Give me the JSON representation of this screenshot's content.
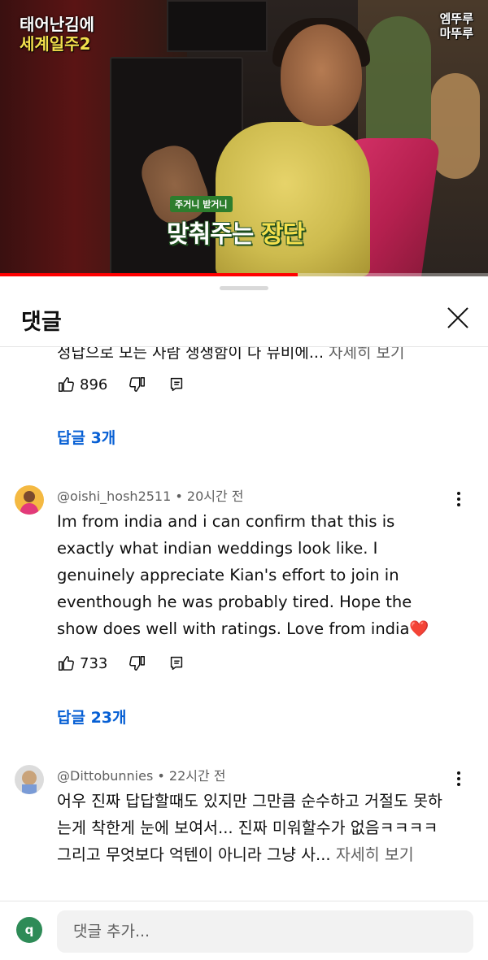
{
  "video": {
    "logo_left_line1": "태어난김에",
    "logo_left_line2": "세계일주2",
    "logo_right_line1": "엠뚜루",
    "logo_right_line2": "마뚜루",
    "caption_small": "주거니 받거니",
    "caption_main_a": "맞춰주는 ",
    "caption_main_b": "장단",
    "progress": 0.61,
    "colors": {
      "progress": "#ff0000"
    }
  },
  "sheet": {
    "title": "댓글",
    "close_icon": "close-icon"
  },
  "truncated_comment": {
    "text": "정답으로 모든 사람 생생함이 다 뮤비에...",
    "more": "자세히 보기",
    "likes": "896",
    "replies": "답글 3개"
  },
  "comments": [
    {
      "author": "@oishi_hosh2511",
      "time": "20시간 전",
      "text": "Im from india and i can confirm that this is exactly what indian weddings look like. I genuinely appreciate Kian's effort to join in eventhough he was probably tired. Hope the show does well with ratings. Love from india",
      "emoji": "❤️",
      "likes": "733",
      "replies": "답글 23개"
    },
    {
      "author": "@Dittobunnies",
      "time": "22시간 전",
      "text_line1": "어우 진짜 답답할때도 있지만 그만큼 순수하고 거절도 못하는게 착한게 눈에 보여서... 진짜 미워할수가 없음ㅋㅋㅋㅋ",
      "text_line2": "그리고 무엇보다 억텐이 아니라 그냥 사...",
      "more": "자세히 보기"
    }
  ],
  "composer": {
    "avatar_letter": "q",
    "placeholder": "댓글 추가..."
  }
}
